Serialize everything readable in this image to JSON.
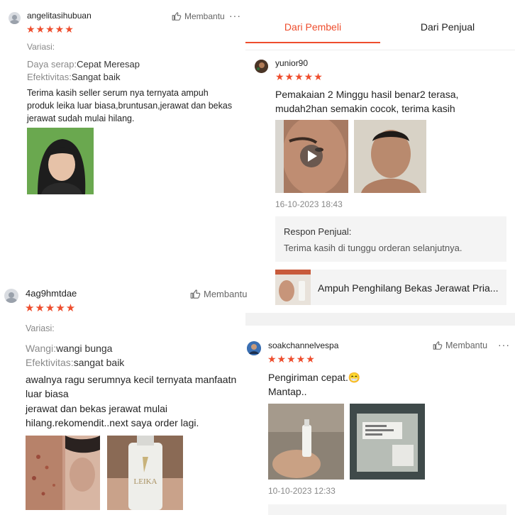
{
  "colors": {
    "accent": "#ee4d2d",
    "star": "#ee4d2d"
  },
  "stars_text": "★★★★★",
  "more_text": "···",
  "review1": {
    "user": "angelitasihubuan",
    "like": "Membantu",
    "variasi": "Variasi:",
    "attr1_key": "Daya serap:",
    "attr1_val": "Cepat Meresap",
    "attr2_key": "Efektivitas:",
    "attr2_val": "Sangat baik",
    "body": "Terima kasih seller serum nya ternyata ampuh produk leika luar biasa,bruntusan,jerawat dan bekas jerawat sudah mulai hilang."
  },
  "review2": {
    "user": "4ag9hmtdae",
    "like": "Membantu",
    "variasi": "Variasi:",
    "attr1_key": "Wangi:",
    "attr1_val": "wangi bunga",
    "attr2_key": "Efektivitas:",
    "attr2_val": "sangat baik",
    "body_line1": "awalnya ragu serumnya kecil ternyata manfaatn",
    "body_line2": "luar biasa",
    "body_line3": "jerawat dan bekas jerawat mulai",
    "body_line4": "hilang.rekomendit..next saya order lagi."
  },
  "tabs": {
    "buyer": "Dari Pembeli",
    "seller": "Dari Penjual"
  },
  "review3": {
    "user": "yunior90",
    "body_line1": "Pemakaian 2 Minggu hasil benar2 terasa,",
    "body_line2": "mudah2han semakin cocok, terima kasih",
    "date": "16-10-2023 18:43",
    "seller_response_title": "Respon Penjual:",
    "seller_response_text": "Terima kasih di tunggu orderan selanjutnya.",
    "product_name": "Ampuh Penghilang Bekas Jerawat Pria..."
  },
  "review4": {
    "user": "soakchannelvespa",
    "like": "Membantu",
    "body_line1": "Pengiriman cepat.😁",
    "body_line2": "Mantap..",
    "date": "10-10-2023 12:33"
  }
}
